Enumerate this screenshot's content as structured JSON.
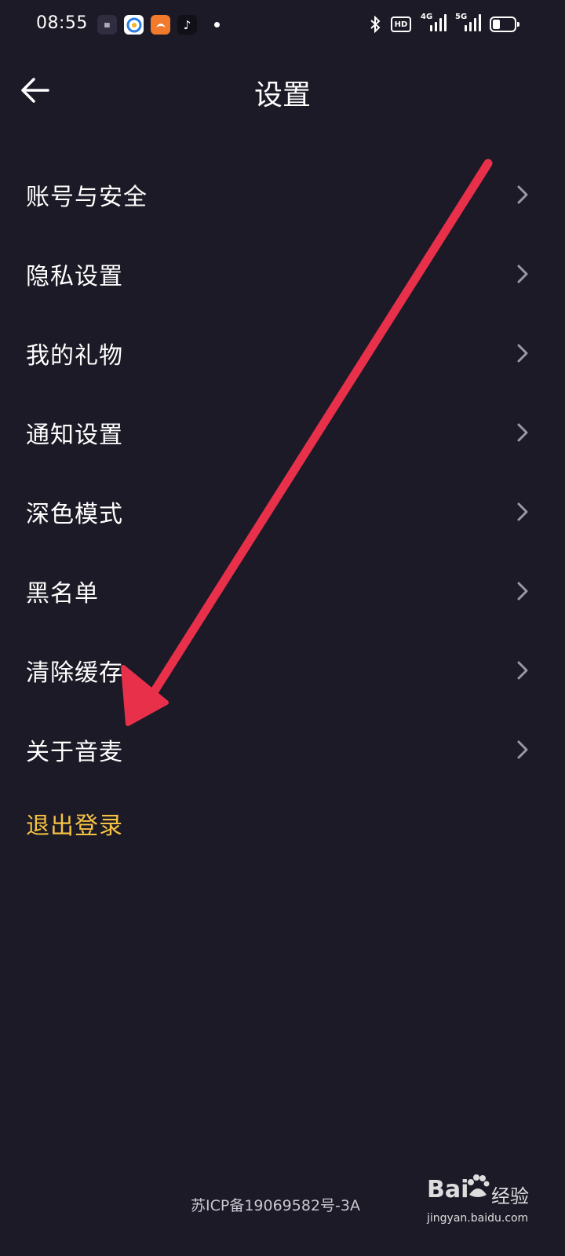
{
  "status_bar": {
    "time": "08:55",
    "app_icons": [
      "map-app-icon",
      "browser-app-icon",
      "uc-browser-app-icon",
      "tiktok-app-icon"
    ],
    "hd_badge": "HD",
    "net_label_1": "4G",
    "net_label_2": "5G",
    "battery_level": 0.35
  },
  "header": {
    "title": "设置",
    "back_icon": "arrow-left-icon"
  },
  "menu": {
    "items": [
      {
        "label": "账号与安全"
      },
      {
        "label": "隐私设置"
      },
      {
        "label": "我的礼物"
      },
      {
        "label": "通知设置"
      },
      {
        "label": "深色模式"
      },
      {
        "label": "黑名单"
      },
      {
        "label": "清除缓存"
      },
      {
        "label": "关于音麦"
      }
    ],
    "logout_label": "退出登录"
  },
  "footer": {
    "icp": "苏ICP备19069582号-3A"
  },
  "watermark": {
    "brand": "Bai",
    "product": "经验",
    "url": "jingyan.baidu.com"
  },
  "colors": {
    "background": "#1b1a26",
    "logout": "#f5c243",
    "annotation_arrow": "#e8304a",
    "chevron": "#9a99a3"
  }
}
